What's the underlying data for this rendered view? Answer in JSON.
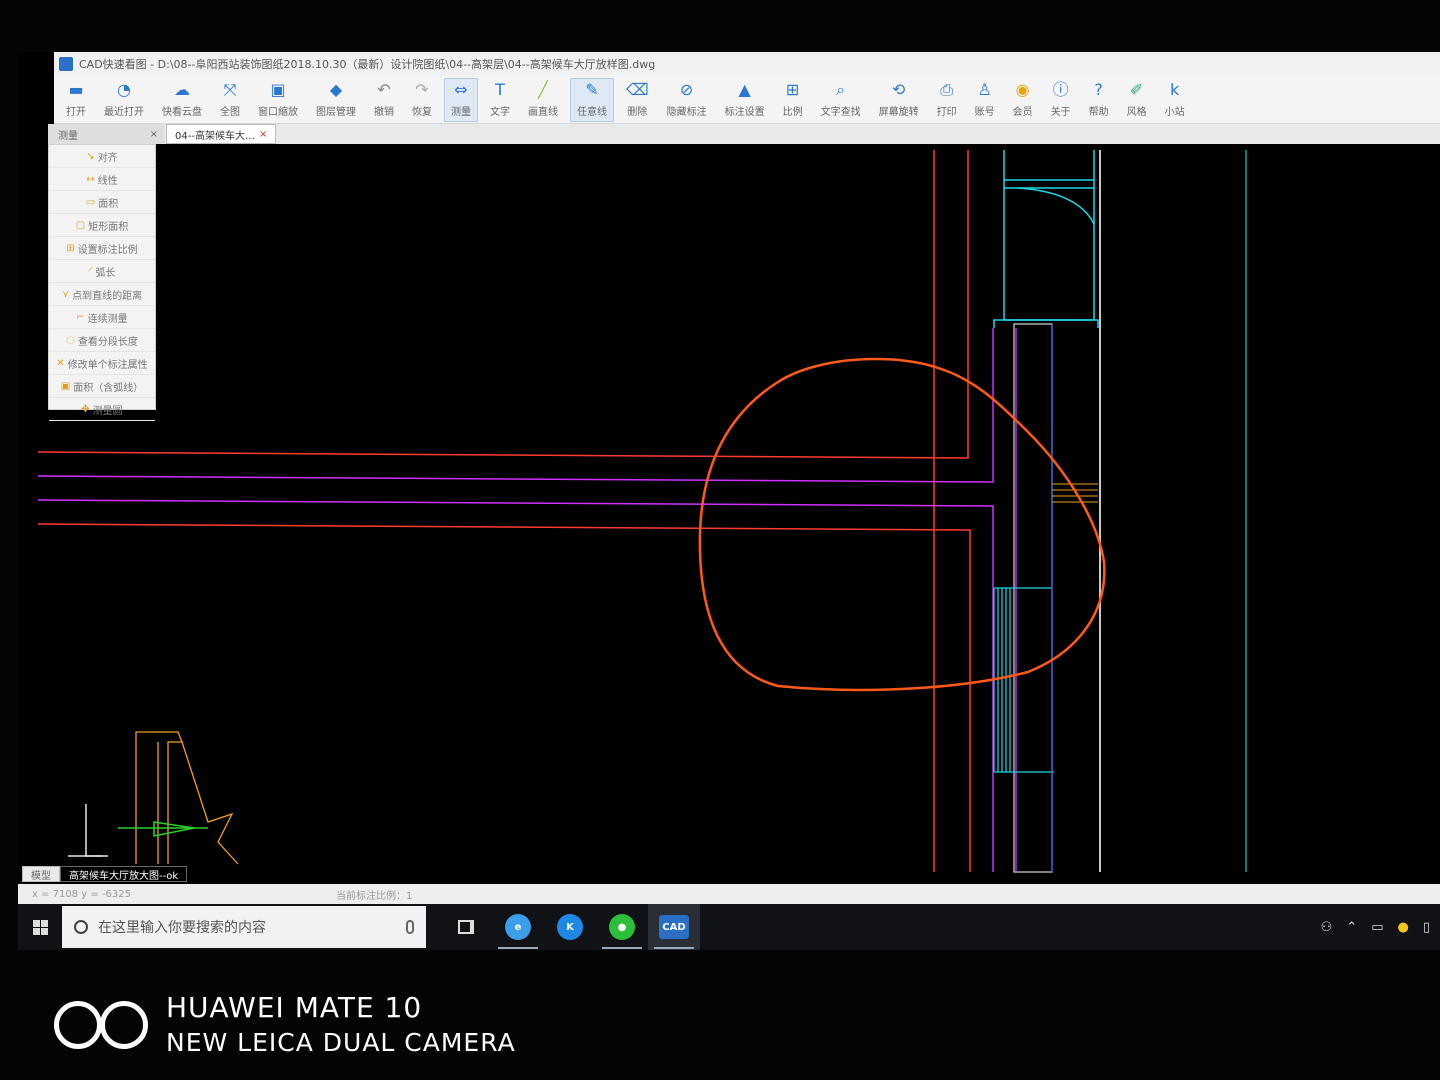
{
  "window": {
    "title": "CAD快速看图 - D:\\08--阜阳西站装饰图纸2018.10.30（最新）设计院图纸\\04--高架层\\04--高架候车大厅放样图.dwg"
  },
  "toolbar": {
    "items": [
      {
        "label": "打开",
        "icon": "folder-icon",
        "glyph": "▬",
        "color": "#2b78d0"
      },
      {
        "label": "最近打开",
        "icon": "history-icon",
        "glyph": "◔",
        "color": "#2b78d0"
      },
      {
        "label": "快看云盘",
        "icon": "cloud-icon",
        "glyph": "☁",
        "color": "#2b78d0"
      },
      {
        "label": "全图",
        "icon": "fit-all-icon",
        "glyph": "⤧",
        "color": "#2b78d0"
      },
      {
        "label": "窗口缩放",
        "icon": "window-zoom-icon",
        "glyph": "▣",
        "color": "#2b78d0"
      },
      {
        "label": "图层管理",
        "icon": "layers-icon",
        "glyph": "◆",
        "color": "#2b78d0"
      },
      {
        "label": "撤销",
        "icon": "undo-icon",
        "glyph": "↶",
        "color": "#888888"
      },
      {
        "label": "恢复",
        "icon": "redo-icon",
        "glyph": "↷",
        "color": "#aaaaaa"
      },
      {
        "label": "测量",
        "icon": "measure-icon",
        "glyph": "⇔",
        "color": "#2b78d0",
        "active": true
      },
      {
        "label": "文字",
        "icon": "text-icon",
        "glyph": "T",
        "color": "#2b78d0"
      },
      {
        "label": "画直线",
        "icon": "line-icon",
        "glyph": "╱",
        "color": "#8bc34a"
      },
      {
        "label": "任意线",
        "icon": "freehand-icon",
        "glyph": "✎",
        "color": "#2b78d0",
        "active": true
      },
      {
        "label": "删除",
        "icon": "eraser-icon",
        "glyph": "⌫",
        "color": "#2b78d0"
      },
      {
        "label": "隐藏标注",
        "icon": "hide-annotation-icon",
        "glyph": "⊘",
        "color": "#2b78d0"
      },
      {
        "label": "标注设置",
        "icon": "annotation-settings-icon",
        "glyph": "▲",
        "color": "#2b78d0"
      },
      {
        "label": "比例",
        "icon": "scale-icon",
        "glyph": "⊞",
        "color": "#2b78d0"
      },
      {
        "label": "文字查找",
        "icon": "text-search-icon",
        "glyph": "⌕",
        "color": "#2b78d0"
      },
      {
        "label": "屏幕旋转",
        "icon": "rotate-screen-icon",
        "glyph": "⟲",
        "color": "#2b78d0"
      },
      {
        "label": "打印",
        "icon": "print-icon",
        "glyph": "⎙",
        "color": "#2b78d0"
      },
      {
        "label": "账号",
        "icon": "account-icon",
        "glyph": "♙",
        "color": "#2b78d0"
      },
      {
        "label": "会员",
        "icon": "vip-icon",
        "glyph": "◉",
        "color": "#e8a400"
      },
      {
        "label": "关于",
        "icon": "info-icon",
        "glyph": "ⓘ",
        "color": "#2b78d0"
      },
      {
        "label": "帮助",
        "icon": "help-icon",
        "glyph": "?",
        "color": "#2b78d0"
      },
      {
        "label": "风格",
        "icon": "style-icon",
        "glyph": "✐",
        "color": "#2aa876"
      },
      {
        "label": "小站",
        "icon": "kuai-station-icon",
        "glyph": "k",
        "color": "#2b78d0"
      }
    ]
  },
  "tabs": {
    "panel_title": "测量",
    "panel_close": "×",
    "document_tab": "04--高架候车大…",
    "document_close": "×"
  },
  "measure_panel": {
    "items": [
      {
        "label": "对齐",
        "icon": "align-icon",
        "glyph": "↘"
      },
      {
        "label": "线性",
        "icon": "linear-icon",
        "glyph": "↔"
      },
      {
        "label": "面积",
        "icon": "area-icon",
        "glyph": "▭"
      },
      {
        "label": "矩形面积",
        "icon": "rect-area-icon",
        "glyph": "▢"
      },
      {
        "label": "设置标注比例",
        "icon": "set-scale-icon",
        "glyph": "⊞"
      },
      {
        "label": "弧长",
        "icon": "arc-length-icon",
        "glyph": "◜"
      },
      {
        "label": "点到直线的距离",
        "icon": "point-line-icon",
        "glyph": "⋎"
      },
      {
        "label": "连续测量",
        "icon": "continuous-measure-icon",
        "glyph": "⌐"
      },
      {
        "label": "查看分段长度",
        "icon": "segment-length-icon",
        "glyph": "◌"
      },
      {
        "label": "修改单个标注属性",
        "icon": "edit-annotation-icon",
        "glyph": "✕"
      },
      {
        "label": "面积（含弧线）",
        "icon": "arc-area-icon",
        "glyph": "▣"
      },
      {
        "label": "测量圆",
        "icon": "measure-circle-icon",
        "glyph": "✥"
      }
    ]
  },
  "layout_tabs": {
    "model": "模型",
    "layout": "高架候车大厅放大图--ok"
  },
  "status": {
    "coords": "x = 7108  y = -6325",
    "scale": "当前标注比例：1"
  },
  "taskbar": {
    "search_placeholder": "在这里输入你要搜索的内容",
    "apps": [
      {
        "name": "task-view",
        "icon": "task-view-icon"
      },
      {
        "name": "ie",
        "icon": "ie-browser-icon",
        "color": "#3a9ee8",
        "glyph": "e",
        "running": true
      },
      {
        "name": "kugou",
        "icon": "kugou-music-icon",
        "color": "#1e88e5",
        "glyph": "K",
        "running": false
      },
      {
        "name": "wechat",
        "icon": "wechat-icon",
        "color": "#2dbe3a",
        "glyph": "●",
        "running": true
      },
      {
        "name": "cad",
        "icon": "cad-viewer-icon",
        "color": "#2b6fc4",
        "glyph": "CAD",
        "running": true,
        "focused": true
      }
    ]
  },
  "tray": {
    "icons": [
      "people-icon",
      "chevron-up-icon",
      "battery-icon",
      "security-shield-icon",
      "network-icon"
    ]
  },
  "camera_watermark": {
    "line1": "HUAWEI MATE 10",
    "line2": "NEW LEICA DUAL CAMERA"
  },
  "colors": {
    "canvas": "#000000",
    "red_line": "#ff3b2f",
    "purple_line": "#d030ff",
    "cyan_line": "#20d8e8",
    "white_line": "#c8c8c8",
    "orange_markup": "#ff5a1a",
    "teal_line": "#1aa89a",
    "green_ucs": "#2ad02a",
    "yellow_detail": "#f0a020"
  }
}
